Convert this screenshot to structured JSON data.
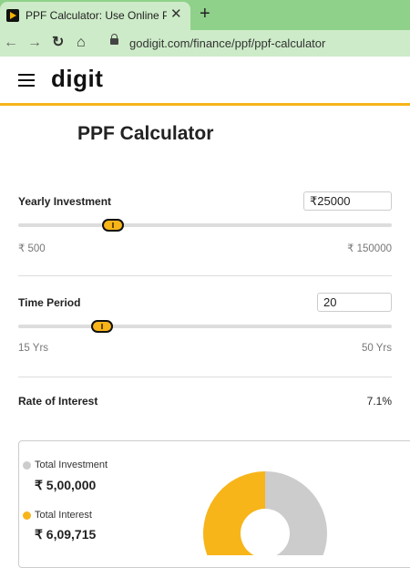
{
  "browser": {
    "tab_title": "PPF Calculator: Use Online PPF Calc",
    "tab_close": "✕",
    "new_tab": "+",
    "url": "godigit.com/finance/ppf/ppf-calculator"
  },
  "header": {
    "logo": "digit"
  },
  "calculator": {
    "title": "PPF Calculator",
    "yearly_investment": {
      "label": "Yearly Investment",
      "value": "₹25000",
      "min_label": "₹ 500",
      "max_label": "₹ 150000",
      "slider_fraction": 0.25
    },
    "time_period": {
      "label": "Time Period",
      "value": "20",
      "min_label": "15 Yrs",
      "max_label": "50 Yrs",
      "slider_fraction": 0.22
    },
    "rate_of_interest": {
      "label": "Rate of Interest",
      "value": "7.1%"
    }
  },
  "summary": {
    "total_investment": {
      "label": "Total Investment",
      "amount": "₹ 5,00,000",
      "color": "#cccccc",
      "value": 500000
    },
    "total_interest": {
      "label": "Total Interest",
      "amount": "₹ 6,09,715",
      "color": "#f7b51a",
      "value": 609715
    }
  },
  "colors": {
    "accent": "#f7b51a",
    "browser_tab_bg": "#8fd18a"
  }
}
